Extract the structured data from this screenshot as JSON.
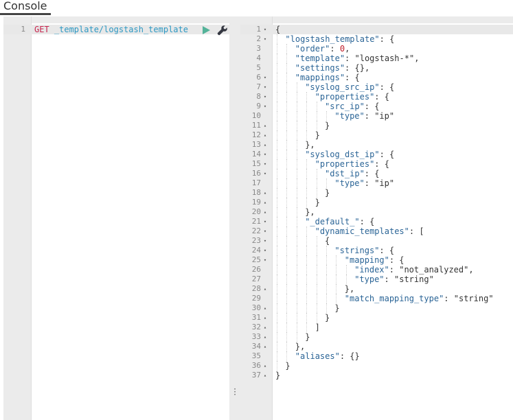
{
  "header": {
    "tab_label": "Console"
  },
  "request_editor": {
    "lines": [
      {
        "number": "1",
        "method": "GET",
        "path": " _template/logstash_template"
      }
    ],
    "send_icon": "play-icon",
    "settings_icon": "wrench-icon"
  },
  "response_viewer": {
    "lines": [
      {
        "number": "1",
        "fold": "▾",
        "indent": 0,
        "parts": [
          [
            "s",
            "{"
          ]
        ]
      },
      {
        "number": "2",
        "fold": "▾",
        "indent": 1,
        "parts": [
          [
            "k",
            "\"logstash_template\""
          ],
          [
            "s",
            ": {"
          ]
        ]
      },
      {
        "number": "3",
        "fold": "",
        "indent": 2,
        "parts": [
          [
            "k",
            "\"order\""
          ],
          [
            "s",
            ": "
          ],
          [
            "n",
            "0"
          ],
          [
            "s",
            ","
          ]
        ]
      },
      {
        "number": "4",
        "fold": "",
        "indent": 2,
        "parts": [
          [
            "k",
            "\"template\""
          ],
          [
            "s",
            ": \"logstash-*\","
          ]
        ]
      },
      {
        "number": "5",
        "fold": "",
        "indent": 2,
        "parts": [
          [
            "k",
            "\"settings\""
          ],
          [
            "s",
            ": {},"
          ]
        ]
      },
      {
        "number": "6",
        "fold": "▾",
        "indent": 2,
        "parts": [
          [
            "k",
            "\"mappings\""
          ],
          [
            "s",
            ": {"
          ]
        ]
      },
      {
        "number": "7",
        "fold": "▾",
        "indent": 3,
        "parts": [
          [
            "k",
            "\"syslog_src_ip\""
          ],
          [
            "s",
            ": {"
          ]
        ]
      },
      {
        "number": "8",
        "fold": "▾",
        "indent": 4,
        "parts": [
          [
            "k",
            "\"properties\""
          ],
          [
            "s",
            ": {"
          ]
        ]
      },
      {
        "number": "9",
        "fold": "▾",
        "indent": 5,
        "parts": [
          [
            "k",
            "\"src_ip\""
          ],
          [
            "s",
            ": {"
          ]
        ]
      },
      {
        "number": "10",
        "fold": "",
        "indent": 6,
        "parts": [
          [
            "k",
            "\"type\""
          ],
          [
            "s",
            ": \"ip\""
          ]
        ]
      },
      {
        "number": "11",
        "fold": "▴",
        "indent": 5,
        "parts": [
          [
            "s",
            "}"
          ]
        ]
      },
      {
        "number": "12",
        "fold": "▴",
        "indent": 4,
        "parts": [
          [
            "s",
            "}"
          ]
        ]
      },
      {
        "number": "13",
        "fold": "▴",
        "indent": 3,
        "parts": [
          [
            "s",
            "},"
          ]
        ]
      },
      {
        "number": "14",
        "fold": "▾",
        "indent": 3,
        "parts": [
          [
            "k",
            "\"syslog_dst_ip\""
          ],
          [
            "s",
            ": {"
          ]
        ]
      },
      {
        "number": "15",
        "fold": "▾",
        "indent": 4,
        "parts": [
          [
            "k",
            "\"properties\""
          ],
          [
            "s",
            ": {"
          ]
        ]
      },
      {
        "number": "16",
        "fold": "▾",
        "indent": 5,
        "parts": [
          [
            "k",
            "\"dst_ip\""
          ],
          [
            "s",
            ": {"
          ]
        ]
      },
      {
        "number": "17",
        "fold": "",
        "indent": 6,
        "parts": [
          [
            "k",
            "\"type\""
          ],
          [
            "s",
            ": \"ip\""
          ]
        ]
      },
      {
        "number": "18",
        "fold": "▴",
        "indent": 5,
        "parts": [
          [
            "s",
            "}"
          ]
        ]
      },
      {
        "number": "19",
        "fold": "▴",
        "indent": 4,
        "parts": [
          [
            "s",
            "}"
          ]
        ]
      },
      {
        "number": "20",
        "fold": "▴",
        "indent": 3,
        "parts": [
          [
            "s",
            "},"
          ]
        ]
      },
      {
        "number": "21",
        "fold": "▾",
        "indent": 3,
        "parts": [
          [
            "k",
            "\"_default_\""
          ],
          [
            "s",
            ": {"
          ]
        ]
      },
      {
        "number": "22",
        "fold": "▾",
        "indent": 4,
        "parts": [
          [
            "k",
            "\"dynamic_templates\""
          ],
          [
            "s",
            ": ["
          ]
        ]
      },
      {
        "number": "23",
        "fold": "▾",
        "indent": 5,
        "parts": [
          [
            "s",
            "{"
          ]
        ]
      },
      {
        "number": "24",
        "fold": "▾",
        "indent": 6,
        "parts": [
          [
            "k",
            "\"strings\""
          ],
          [
            "s",
            ": {"
          ]
        ]
      },
      {
        "number": "25",
        "fold": "▾",
        "indent": 7,
        "parts": [
          [
            "k",
            "\"mapping\""
          ],
          [
            "s",
            ": {"
          ]
        ]
      },
      {
        "number": "26",
        "fold": "",
        "indent": 8,
        "parts": [
          [
            "k",
            "\"index\""
          ],
          [
            "s",
            ": \"not_analyzed\","
          ]
        ]
      },
      {
        "number": "27",
        "fold": "",
        "indent": 8,
        "parts": [
          [
            "k",
            "\"type\""
          ],
          [
            "s",
            ": \"string\""
          ]
        ]
      },
      {
        "number": "28",
        "fold": "▴",
        "indent": 7,
        "parts": [
          [
            "s",
            "},"
          ]
        ]
      },
      {
        "number": "29",
        "fold": "",
        "indent": 7,
        "parts": [
          [
            "k",
            "\"match_mapping_type\""
          ],
          [
            "s",
            ": \"string\""
          ]
        ]
      },
      {
        "number": "30",
        "fold": "▴",
        "indent": 6,
        "parts": [
          [
            "s",
            "}"
          ]
        ]
      },
      {
        "number": "31",
        "fold": "▴",
        "indent": 5,
        "parts": [
          [
            "s",
            "}"
          ]
        ]
      },
      {
        "number": "32",
        "fold": "▴",
        "indent": 4,
        "parts": [
          [
            "s",
            "]"
          ]
        ]
      },
      {
        "number": "33",
        "fold": "▴",
        "indent": 3,
        "parts": [
          [
            "s",
            "}"
          ]
        ]
      },
      {
        "number": "34",
        "fold": "▴",
        "indent": 2,
        "parts": [
          [
            "s",
            "},"
          ]
        ]
      },
      {
        "number": "35",
        "fold": "",
        "indent": 2,
        "parts": [
          [
            "k",
            "\"aliases\""
          ],
          [
            "s",
            ": {}"
          ]
        ]
      },
      {
        "number": "36",
        "fold": "▴",
        "indent": 1,
        "parts": [
          [
            "s",
            "}"
          ]
        ]
      },
      {
        "number": "37",
        "fold": "▴",
        "indent": 0,
        "parts": [
          [
            "s",
            "}"
          ]
        ]
      }
    ]
  },
  "splitter_icon": "vertical-dots-icon",
  "colors": {
    "method": "#c7254e",
    "url": "#2d98c3",
    "key": "#2a6496",
    "number": "#c01c28",
    "play": "#54b399"
  }
}
